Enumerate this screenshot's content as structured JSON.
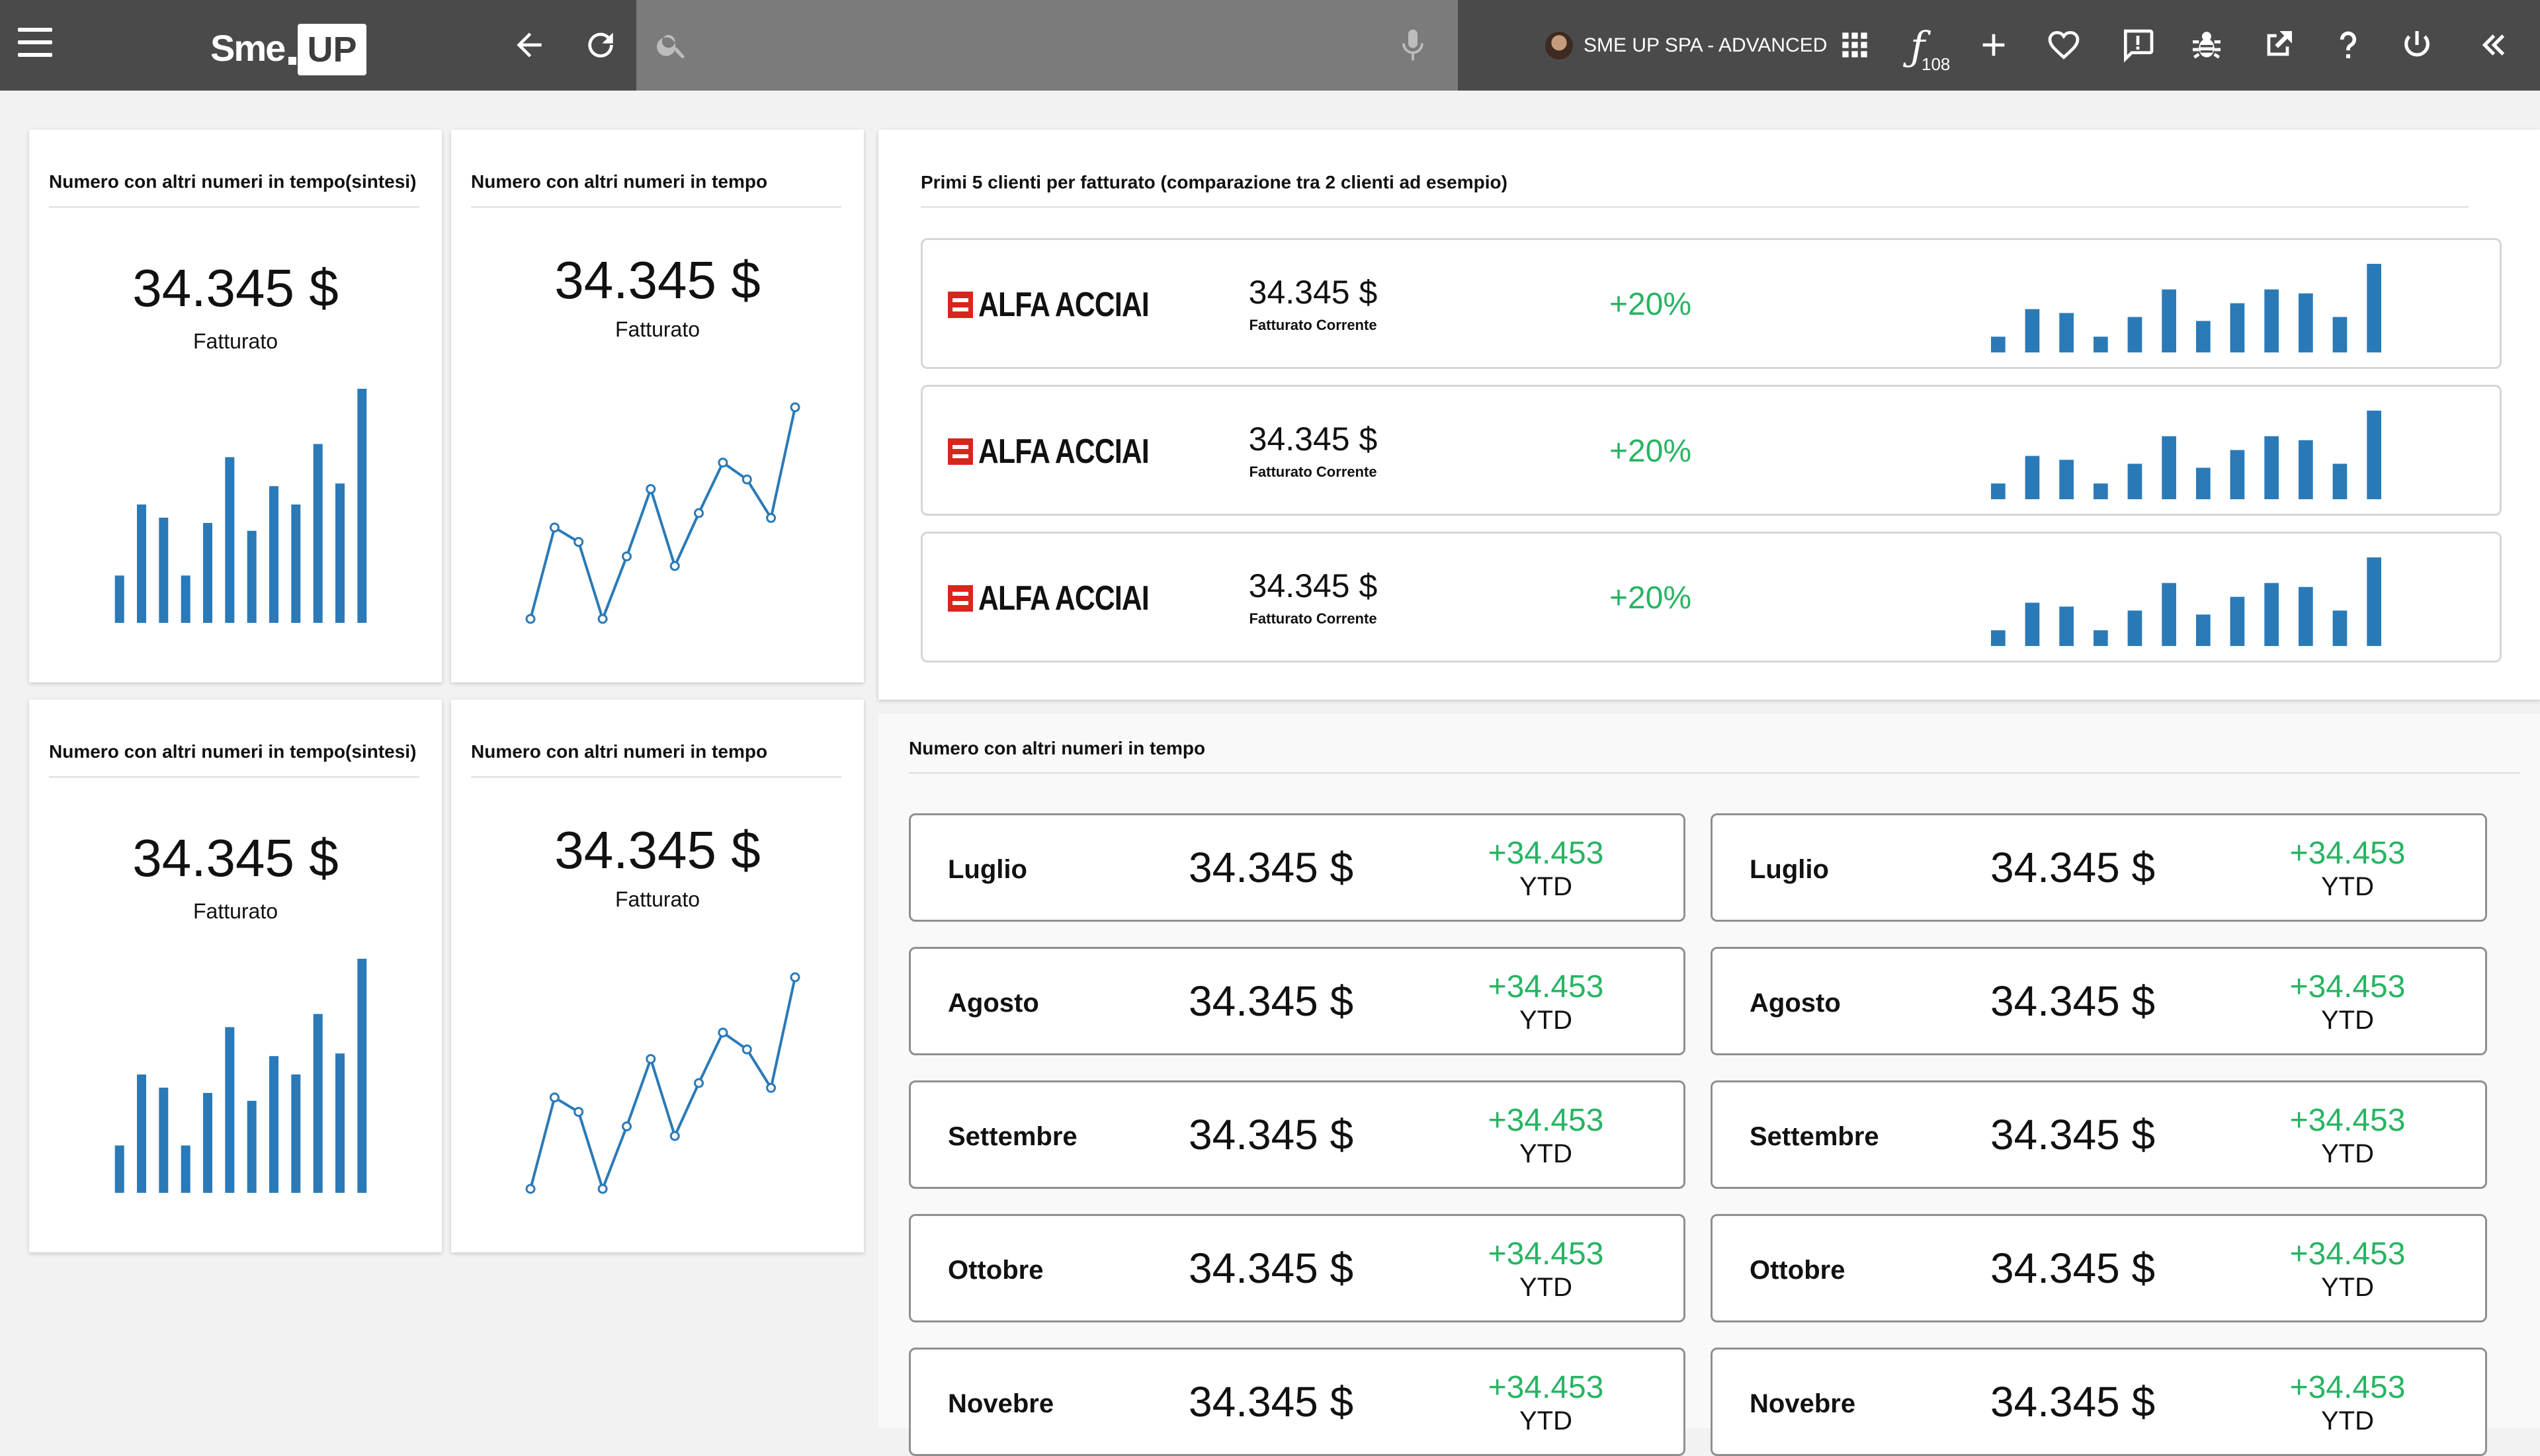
{
  "brand": {
    "logo_left": "Sme",
    "logo_right": "UP"
  },
  "toolbar": {
    "user_label": "SME UP SPA - ADVANCED",
    "functions_count": "108",
    "icons": [
      "apps-grid-icon",
      "function-icon",
      "plus-icon",
      "heart-icon",
      "feedback-icon",
      "bug-icon",
      "open-external-icon",
      "help-icon",
      "power-icon",
      "collapse-icon"
    ]
  },
  "colors": {
    "accent": "#2a7ab8",
    "positive": "#28b463",
    "topbar": "#4a4a4a",
    "search": "#7b7b7b"
  },
  "kpi_cards": [
    {
      "title": "Numero con altri numeri in tempo(sintesi)",
      "value": "34.345 $",
      "label": "Fatturato",
      "chart": "bar"
    },
    {
      "title": "Numero con altri numeri in tempo",
      "value": "34.345 $",
      "label": "Fatturato",
      "chart": "line"
    },
    {
      "title": "Numero con altri numeri in tempo(sintesi)",
      "value": "34.345 $",
      "label": "Fatturato",
      "chart": "bar"
    },
    {
      "title": "Numero con altri numeri in tempo",
      "value": "34.345 $",
      "label": "Fatturato",
      "chart": "line"
    }
  ],
  "clients_panel": {
    "title": "Primi 5 clienti per fatturato (comparazione tra 2 clienti ad esempio)",
    "clients": [
      {
        "logo_text": "ALFA ACCIAI",
        "value": "34.345 $",
        "sub": "Fatturato Corrente",
        "delta": "+20%"
      },
      {
        "logo_text": "ALFA ACCIAI",
        "value": "34.345 $",
        "sub": "Fatturato Corrente",
        "delta": "+20%"
      },
      {
        "logo_text": "ALFA ACCIAI",
        "value": "34.345 $",
        "sub": "Fatturato Corrente",
        "delta": "+20%"
      }
    ]
  },
  "months_panel": {
    "title": "Numero con altri numeri in tempo",
    "rows": [
      {
        "month": "Luglio",
        "value": "34.345 $",
        "delta": "+34.453",
        "unit": "YTD"
      },
      {
        "month": "Agosto",
        "value": "34.345 $",
        "delta": "+34.453",
        "unit": "YTD"
      },
      {
        "month": "Settembre",
        "value": "34.345 $",
        "delta": "+34.453",
        "unit": "YTD"
      },
      {
        "month": "Ottobre",
        "value": "34.345 $",
        "delta": "+34.453",
        "unit": "YTD"
      },
      {
        "month": "Novebre",
        "value": "34.345 $",
        "delta": "+34.453",
        "unit": "YTD"
      }
    ]
  },
  "chart_data": [
    {
      "type": "bar",
      "categories": [
        "1",
        "2",
        "3",
        "4",
        "5",
        "6",
        "7",
        "8",
        "9",
        "10",
        "11",
        "12"
      ],
      "values": [
        18,
        45,
        40,
        18,
        38,
        63,
        35,
        52,
        45,
        68,
        53,
        89
      ]
    },
    {
      "type": "line",
      "x": [
        1,
        2,
        3,
        4,
        5,
        6,
        7,
        8,
        9,
        10,
        11,
        12
      ],
      "values": [
        0,
        38,
        32,
        0,
        26,
        54,
        22,
        44,
        65,
        58,
        42,
        88
      ]
    },
    {
      "type": "bar",
      "categories": [
        "1",
        "2",
        "3",
        "4",
        "5",
        "6",
        "7",
        "8",
        "9",
        "10",
        "11",
        "12"
      ],
      "values": [
        18,
        45,
        40,
        18,
        38,
        63,
        35,
        52,
        45,
        68,
        53,
        89
      ]
    },
    {
      "type": "line",
      "x": [
        1,
        2,
        3,
        4,
        5,
        6,
        7,
        8,
        9,
        10,
        11,
        12
      ],
      "values": [
        0,
        38,
        32,
        0,
        26,
        54,
        22,
        44,
        65,
        58,
        42,
        88
      ]
    },
    {
      "type": "bar",
      "categories": [
        "1",
        "2",
        "3",
        "4",
        "5",
        "6",
        "7",
        "8",
        "9",
        "10",
        "11"
      ],
      "values": [
        8,
        22,
        20,
        8,
        18,
        32,
        16,
        25,
        32,
        30,
        18,
        45
      ]
    },
    {
      "type": "bar",
      "categories": [
        "1",
        "2",
        "3",
        "4",
        "5",
        "6",
        "7",
        "8",
        "9",
        "10",
        "11"
      ],
      "values": [
        8,
        22,
        20,
        8,
        18,
        32,
        16,
        25,
        32,
        30,
        18,
        45
      ]
    },
    {
      "type": "bar",
      "categories": [
        "1",
        "2",
        "3",
        "4",
        "5",
        "6",
        "7",
        "8",
        "9",
        "10",
        "11"
      ],
      "values": [
        8,
        22,
        20,
        8,
        18,
        32,
        16,
        25,
        32,
        30,
        18,
        45
      ]
    }
  ]
}
